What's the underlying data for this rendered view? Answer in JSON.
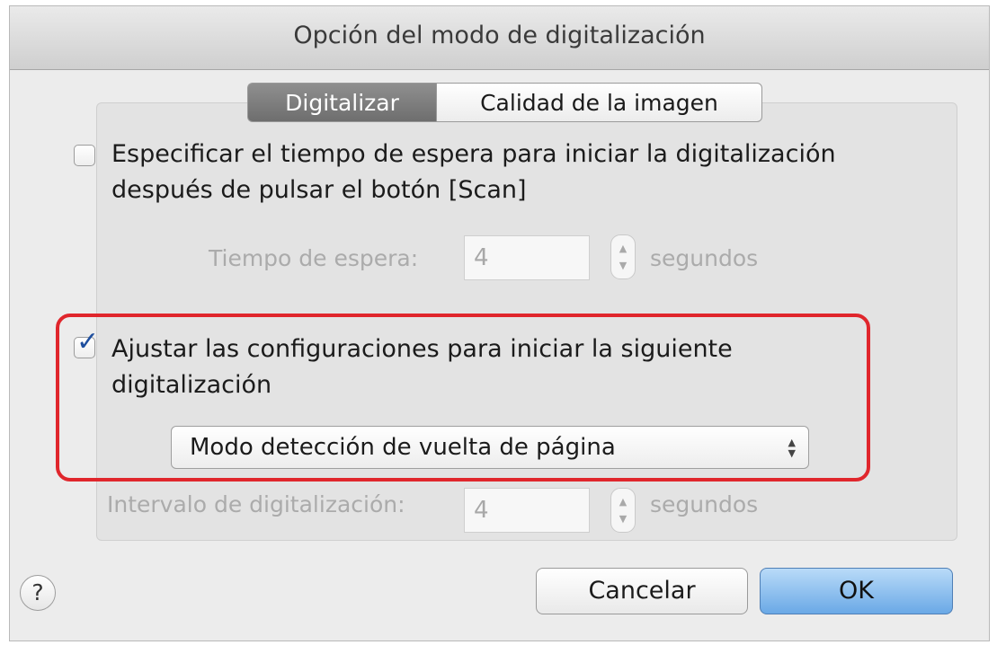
{
  "window": {
    "title": "Opción del modo de digitalización"
  },
  "tabs": [
    {
      "label": "Digitalizar",
      "active": true
    },
    {
      "label": "Calidad de la imagen",
      "active": false
    }
  ],
  "wait_option": {
    "checked": false,
    "label_line1": "Especificar el tiempo de espera para iniciar la digitalización",
    "label_line2": "después de pulsar el botón [Scan]",
    "time_label": "Tiempo de espera:",
    "time_value": "4",
    "time_unit": "segundos"
  },
  "next_scan_option": {
    "checked": true,
    "label_line1": "Ajustar las configuraciones para iniciar la siguiente",
    "label_line2": "digitalización",
    "mode_selected": "Modo detección de vuelta de página"
  },
  "interval": {
    "label": "Intervalo de digitalización:",
    "value": "4",
    "unit": "segundos"
  },
  "buttons": {
    "help": "?",
    "cancel": "Cancelar",
    "ok": "OK"
  },
  "colors": {
    "highlight": "#e0262c",
    "ok_button": "#6aa9e6",
    "check": "#1f4f9e"
  }
}
